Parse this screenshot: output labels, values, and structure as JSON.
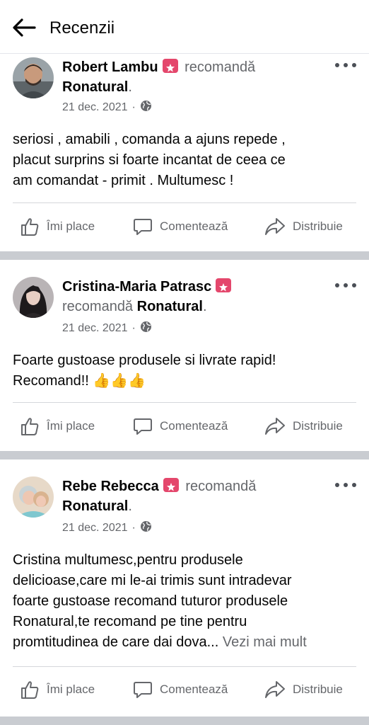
{
  "header": {
    "title": "Recenzii"
  },
  "actions": {
    "like": "Îmi place",
    "comment": "Comentează",
    "share": "Distribuie"
  },
  "reviews": [
    {
      "author": "Robert Lambu",
      "verb": "recomandă",
      "page": "Ronatural",
      "dot": ".",
      "date": "21 dec. 2021",
      "text_lines": [
        "seriosi , amabili , comanda a ajuns repede ,",
        "placut surprins si foarte incantat de ceea ce",
        "am comandat - primit . Multumesc !"
      ]
    },
    {
      "author": "Cristina-Maria Patrasc",
      "verb": "recomandă",
      "page": "Ronatural",
      "dot": ".",
      "date": "21 dec. 2021",
      "text_lines": [
        "Foarte gustoase produsele si livrate rapid!",
        "Recomand!!"
      ],
      "emoji": "👍👍👍"
    },
    {
      "author": "Rebe Rebecca",
      "verb": "recomandă",
      "page": "Ronatural",
      "dot": ".",
      "date": "21 dec. 2021",
      "text_lines": [
        "Cristina multumesc,pentru produsele",
        "delicioase,care mi le-ai trimis sunt intradevar",
        "foarte gustoase recomand tuturor produsele",
        "Ronatural,te recomand pe tine pentru",
        "promtitudinea de care dai dova..."
      ],
      "see_more": "Vezi mai mult"
    }
  ],
  "icons": {
    "back": "arrow-left-icon",
    "badge": "recommend-star-icon",
    "audience": "globe-icon",
    "like": "thumbs-up-icon",
    "comment": "comment-bubble-icon",
    "share": "share-arrow-icon",
    "more": "more-dots-icon"
  },
  "colors": {
    "badge": "#e4476c",
    "secondary_text": "#65676b",
    "separator": "#c9ccd1"
  }
}
